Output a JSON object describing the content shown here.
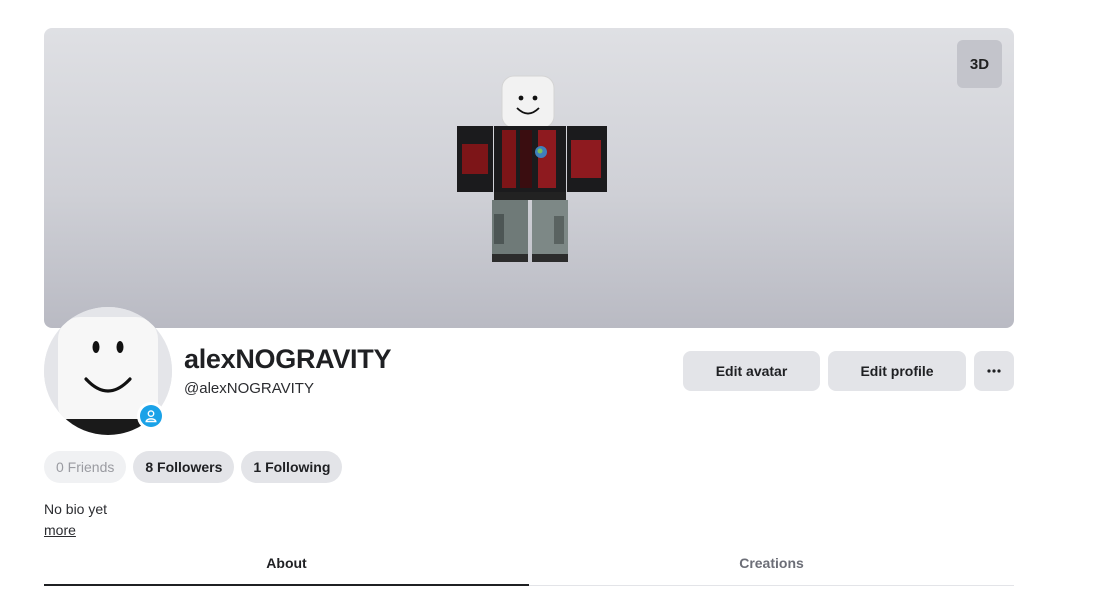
{
  "stage": {
    "toggle_3d_label": "3D"
  },
  "profile": {
    "display_name": "alexNOGRAVITY",
    "username": "@alexNOGRAVITY",
    "presence_color": "#1aa2e8"
  },
  "actions": {
    "edit_avatar": "Edit avatar",
    "edit_profile": "Edit profile",
    "more": "•••"
  },
  "stats": {
    "friends": "0 Friends",
    "followers": "8 Followers",
    "following": "1 Following"
  },
  "bio": {
    "text": "No bio yet",
    "more": "more"
  },
  "tabs": [
    {
      "label": "About",
      "active": true
    },
    {
      "label": "Creations",
      "active": false
    }
  ],
  "colors": {
    "accent_dark": "#1f2023",
    "button_bg": "#e3e4e8",
    "shirt_red": "#8e1a1f"
  }
}
